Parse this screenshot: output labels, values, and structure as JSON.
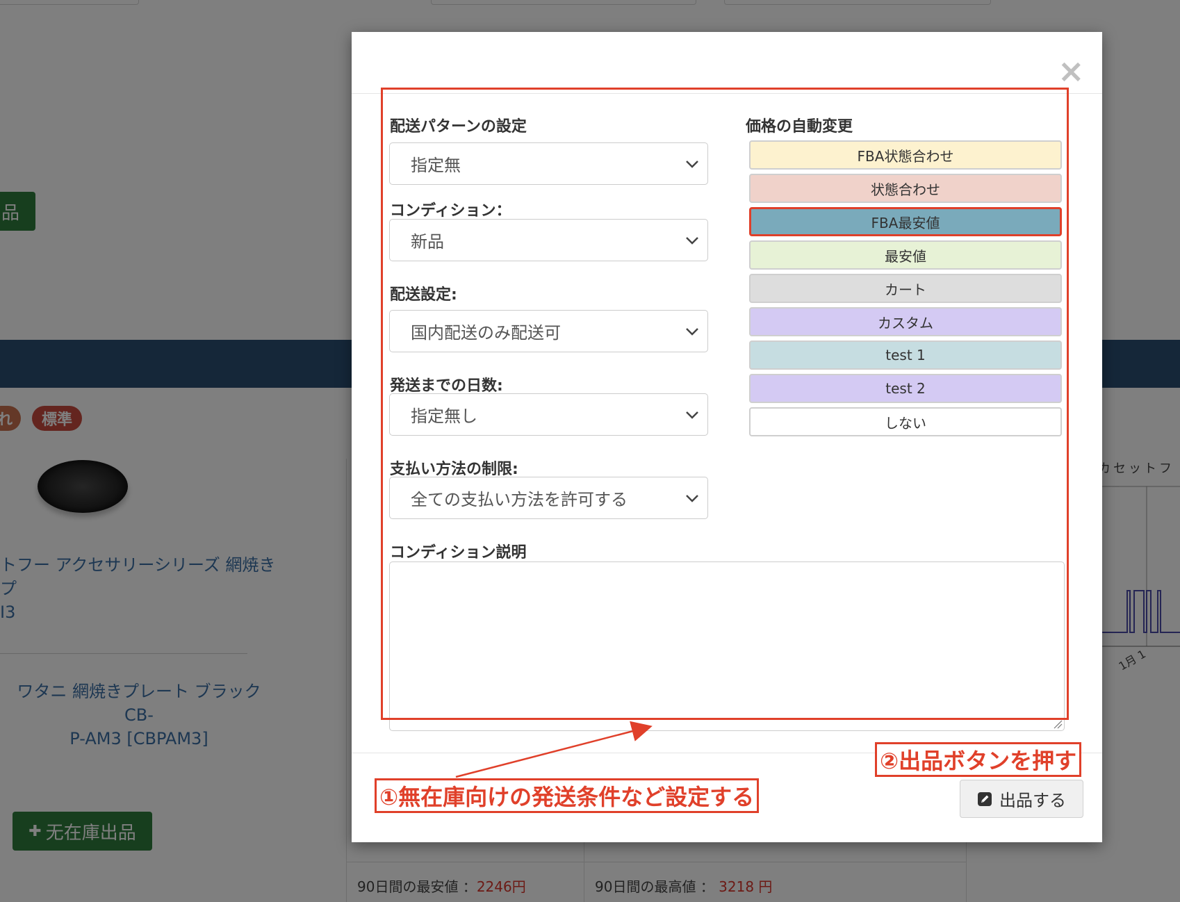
{
  "background": {
    "green_button_top_label": "品",
    "badge_partial": "れ",
    "badge_standard": "標準",
    "product_title_line1": "トフー アクセサリーシリーズ 網焼きプ",
    "product_title_line2": "I3",
    "product_name_line1": "ワタニ 網焼きプレート ブラック CB-",
    "product_name_line2": "P-AM3 [CBPAM3]",
    "mufuzai_button_label": "无在庫出品",
    "mufuzai_button_plus": "✚",
    "low_price_label": "90日間の最安値 ：",
    "low_price_value": "2246円",
    "high_price_label": "90日間の最高値 ：",
    "high_price_value": "3218 円",
    "chart_side_label": "カセットフ",
    "chart_date_label": "1月 1"
  },
  "modal": {
    "close_label": "×",
    "shipping_pattern": {
      "label": "配送パターンの設定",
      "value": "指定無"
    },
    "condition": {
      "label": "コンディション：",
      "value": "新品"
    },
    "shipping_setting": {
      "label": "配送設定:",
      "value": "国内配送のみ配送可"
    },
    "days_to_ship": {
      "label": "発送までの日数:",
      "value": "指定無し"
    },
    "payment_restriction": {
      "label": "支払い方法の制限:",
      "value": "全ての支払い方法を許可する"
    },
    "condition_note": {
      "label": "コンディション説明",
      "value": ""
    },
    "price_auto_change": {
      "label": "価格の自動変更",
      "options": [
        {
          "label": "FBA状態合わせ",
          "color": "#fdf2cf",
          "selected": false
        },
        {
          "label": "状態合わせ",
          "color": "#f0d2ca",
          "selected": false
        },
        {
          "label": "FBA最安値",
          "color": "#7aaabb",
          "selected": true
        },
        {
          "label": "最安値",
          "color": "#e7f2d6",
          "selected": false
        },
        {
          "label": "カート",
          "color": "#dddddd",
          "selected": false
        },
        {
          "label": "カスタム",
          "color": "#d4caf3",
          "selected": false
        },
        {
          "label": "test 1",
          "color": "#c6dde1",
          "selected": false
        },
        {
          "label": "test 2",
          "color": "#d4caf3",
          "selected": false
        },
        {
          "label": "しない",
          "color": "#ffffff",
          "selected": false
        }
      ]
    },
    "submit_label": "出品する",
    "annotation_1": "①無在庫向けの発送条件など設定する",
    "annotation_2": "②出品ボタンを押す",
    "accent_color": "#e0402a"
  }
}
